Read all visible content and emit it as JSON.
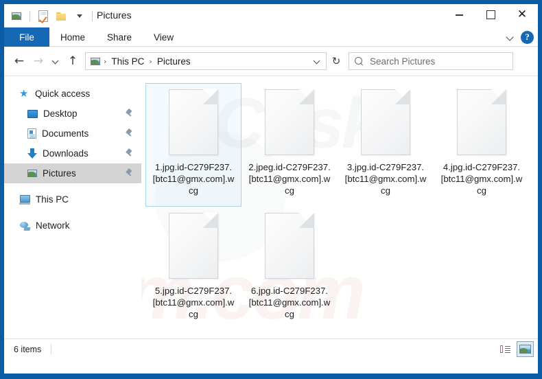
{
  "window": {
    "title": "Pictures",
    "frame_color": "#0b5ca5",
    "accent_color": "#1668b5"
  },
  "quick_access_toolbar": {
    "app_icon": "picture-icon",
    "items": [
      {
        "icon": "properties-checkmark-icon",
        "label": "Properties"
      },
      {
        "icon": "new-folder-icon",
        "label": "New folder"
      },
      {
        "icon": "chevron-down-icon",
        "label": "Customize Quick Access Toolbar"
      }
    ]
  },
  "window_controls": {
    "minimize": "–",
    "maximize": "□",
    "close": "✕"
  },
  "ribbon": {
    "tabs": [
      {
        "label": "File",
        "active": true
      },
      {
        "label": "Home",
        "active": false
      },
      {
        "label": "Share",
        "active": false
      },
      {
        "label": "View",
        "active": false
      }
    ],
    "collapse_icon": "chevron-down-icon",
    "help_label": "?"
  },
  "address_bar": {
    "back": "←",
    "forward": "→",
    "recent": "chevron-down-icon",
    "up": "↑",
    "path_icon": "picture-icon",
    "breadcrumbs": [
      "This PC",
      "Pictures"
    ],
    "separator": "›",
    "dropdown_icon": "chevron-down-icon",
    "refresh": "↻"
  },
  "search": {
    "icon": "search-icon",
    "placeholder": "Search Pictures"
  },
  "sidebar": {
    "items": [
      {
        "label": "Quick access",
        "icon": "star-icon",
        "level": "root",
        "pinned": false,
        "selected": false
      },
      {
        "label": "Desktop",
        "icon": "desktop-icon",
        "level": "child",
        "pinned": true,
        "selected": false
      },
      {
        "label": "Documents",
        "icon": "documents-icon",
        "level": "child",
        "pinned": true,
        "selected": false
      },
      {
        "label": "Downloads",
        "icon": "downloads-icon",
        "level": "child",
        "pinned": true,
        "selected": false
      },
      {
        "label": "Pictures",
        "icon": "picture-icon",
        "level": "child",
        "pinned": true,
        "selected": true
      },
      {
        "label": "This PC",
        "icon": "this-pc-icon",
        "level": "root",
        "pinned": false,
        "selected": false
      },
      {
        "label": "Network",
        "icon": "network-icon",
        "level": "root",
        "pinned": false,
        "selected": false
      }
    ]
  },
  "files": [
    {
      "name": "1.jpg.id-C279F237.[btc11@gmx.com].wcg",
      "icon": "blank-document-icon",
      "selected": true
    },
    {
      "name": "2.jpeg.id-C279F237.[btc11@gmx.com].wcg",
      "icon": "blank-document-icon",
      "selected": false
    },
    {
      "name": "3.jpg.id-C279F237.[btc11@gmx.com].wcg",
      "icon": "blank-document-icon",
      "selected": false
    },
    {
      "name": "4.jpg.id-C279F237.[btc11@gmx.com].wcg",
      "icon": "blank-document-icon",
      "selected": false
    },
    {
      "name": "5.jpg.id-C279F237.[btc11@gmx.com].wcg",
      "icon": "blank-document-icon",
      "selected": false
    },
    {
      "name": "6.jpg.id-C279F237.[btc11@gmx.com].wcg",
      "icon": "blank-document-icon",
      "selected": false
    }
  ],
  "watermark": {
    "top_text": "PCrisk",
    "bottom_text": "rism.com"
  },
  "status_bar": {
    "item_count": "6 items",
    "views": [
      {
        "icon": "details-view-icon",
        "label": "Details view",
        "active": false
      },
      {
        "icon": "large-icons-view-icon",
        "label": "Large icons view",
        "active": true
      }
    ]
  }
}
